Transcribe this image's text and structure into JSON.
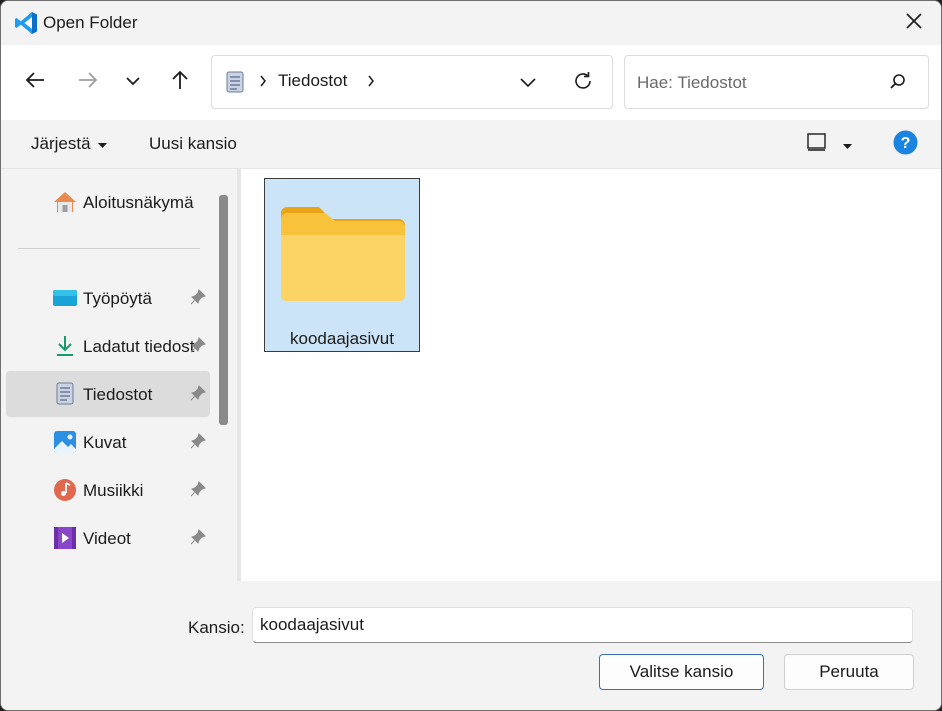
{
  "window": {
    "title": "Open Folder",
    "app_icon": "vscode-icon"
  },
  "navigation": {
    "back_icon": "arrow-left-icon",
    "forward_icon": "arrow-right-icon",
    "recent_icon": "chevron-down-icon",
    "up_icon": "arrow-up-icon"
  },
  "address_bar": {
    "location_icon": "documents-icon",
    "crumbs": [
      "Tiedostot"
    ],
    "refresh_icon": "refresh-icon"
  },
  "search": {
    "placeholder": "Hae: Tiedostot",
    "value": "",
    "icon": "search-icon"
  },
  "command_bar": {
    "organize_label": "Järjestä",
    "new_folder_label": "Uusi kansio",
    "view_icon": "view-icon",
    "help_icon": "help-icon"
  },
  "sidebar": {
    "home": {
      "label": "Aloitusnäkymä",
      "icon": "home-icon"
    },
    "items": [
      {
        "label": "Työpöytä",
        "icon": "desktop-icon",
        "pinned": true,
        "selected": false
      },
      {
        "label": "Ladatut tiedostot",
        "icon": "download-icon",
        "pinned": true,
        "selected": false
      },
      {
        "label": "Tiedostot",
        "icon": "documents-icon",
        "pinned": true,
        "selected": true
      },
      {
        "label": "Kuvat",
        "icon": "pictures-icon",
        "pinned": true,
        "selected": false
      },
      {
        "label": "Musiikki",
        "icon": "music-icon",
        "pinned": true,
        "selected": false
      },
      {
        "label": "Videot",
        "icon": "videos-icon",
        "pinned": true,
        "selected": false
      }
    ]
  },
  "content": {
    "items": [
      {
        "name": "koodaajasivut",
        "icon": "folder-icon",
        "selected": true
      }
    ]
  },
  "footer": {
    "folder_label": "Kansio:",
    "folder_value": "koodaajasivut",
    "select_button": "Valitse kansio",
    "cancel_button": "Peruuta"
  },
  "colors": {
    "accent": "#005fb8",
    "selection": "#cce4f7",
    "folder": "#f8c33a"
  }
}
